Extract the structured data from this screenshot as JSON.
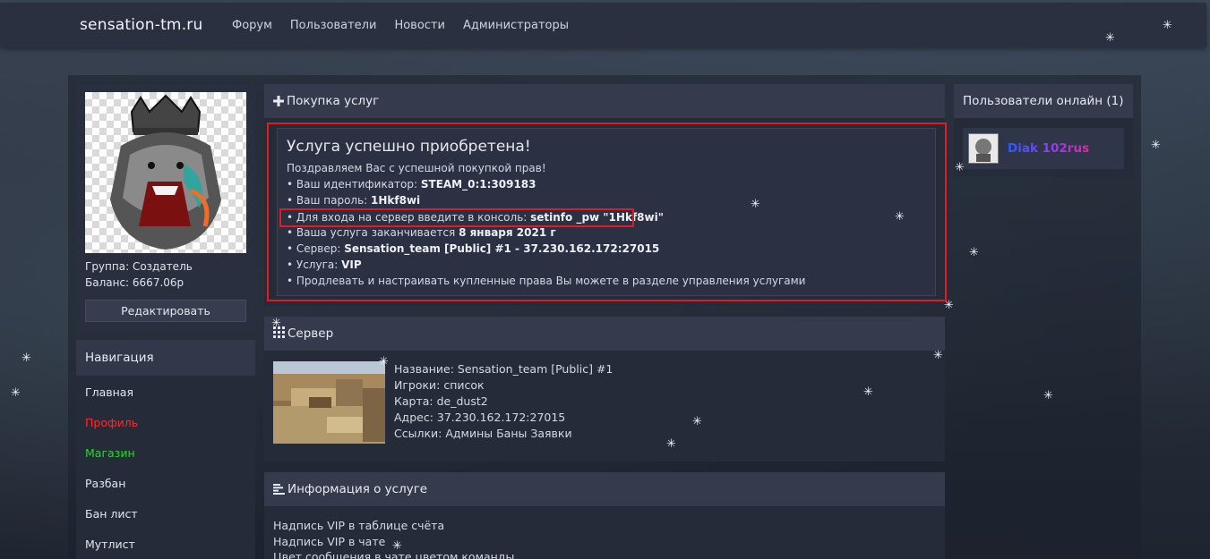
{
  "site": {
    "brand": "sensation-tm.ru"
  },
  "topnav": [
    "Форум",
    "Пользователи",
    "Новости",
    "Администраторы"
  ],
  "profile": {
    "group": "Группа: Создатель",
    "balance": "Баланс: 6667.06р",
    "edit_label": "Редактировать"
  },
  "navigation": {
    "title": "Навигация",
    "items": [
      {
        "label": "Главная",
        "color": "#e3e6ee"
      },
      {
        "label": "Профиль",
        "color": "#ff2a2a"
      },
      {
        "label": "Магазин",
        "color": "#2bd62b"
      },
      {
        "label": "Разбан",
        "color": "#e3e6ee"
      },
      {
        "label": "Бан лист",
        "color": "#e3e6ee"
      },
      {
        "label": "Мутлист",
        "color": "#e3e6ee"
      }
    ]
  },
  "purchase": {
    "header": "Покупка услуг",
    "title": "Услуга успешно приобретена!",
    "congrats": "Поздравляем Вас с успешной покупкой прав!",
    "lines": [
      {
        "prefix": "• Ваш идентификатор: ",
        "value": "STEAM_0:1:309183",
        "suffix": ""
      },
      {
        "prefix": "• Ваш пароль: ",
        "value": "1Hkf8wi",
        "suffix": ""
      },
      {
        "prefix": "• Для входа на сервер введите в консоль: ",
        "value": "setinfo _pw \"1Hkf8wi\"",
        "suffix": ""
      },
      {
        "prefix": "• Ваша услуга заканчивается ",
        "value": "8 января 2021 г",
        "suffix": ""
      },
      {
        "prefix": "• Сервер: ",
        "value": "Sensation_team [Public] #1 - 37.230.162.172:27015",
        "suffix": ""
      },
      {
        "prefix": "• Услуга: ",
        "value": "VIP",
        "suffix": ""
      },
      {
        "prefix": "• Продлевать и настраивать купленные права Вы можете в разделе управления услугами",
        "value": "",
        "suffix": ""
      }
    ]
  },
  "server": {
    "header": "Сервер",
    "name": "Название:  Sensation_team [Public] #1",
    "players": "Игроки:  список",
    "map": "Карта:  de_dust2",
    "address": "Адрес:  37.230.162.172:27015",
    "links": "Ссылки:  Админы Баны Заявки"
  },
  "service_info": {
    "header": "Информация о услуге",
    "lines": [
      "Надпись VIP в таблице счёта",
      "Надпись VIP в чате",
      "Цвет сообщения в чате цветом команды"
    ]
  },
  "online": {
    "header": "Пользователи онлайн (1)",
    "user": "Diak 102rus"
  },
  "icons": {
    "plus": "plus-icon",
    "grid": "grid-icon",
    "list": "list-icon",
    "snowflake": "snowflake-icon"
  }
}
